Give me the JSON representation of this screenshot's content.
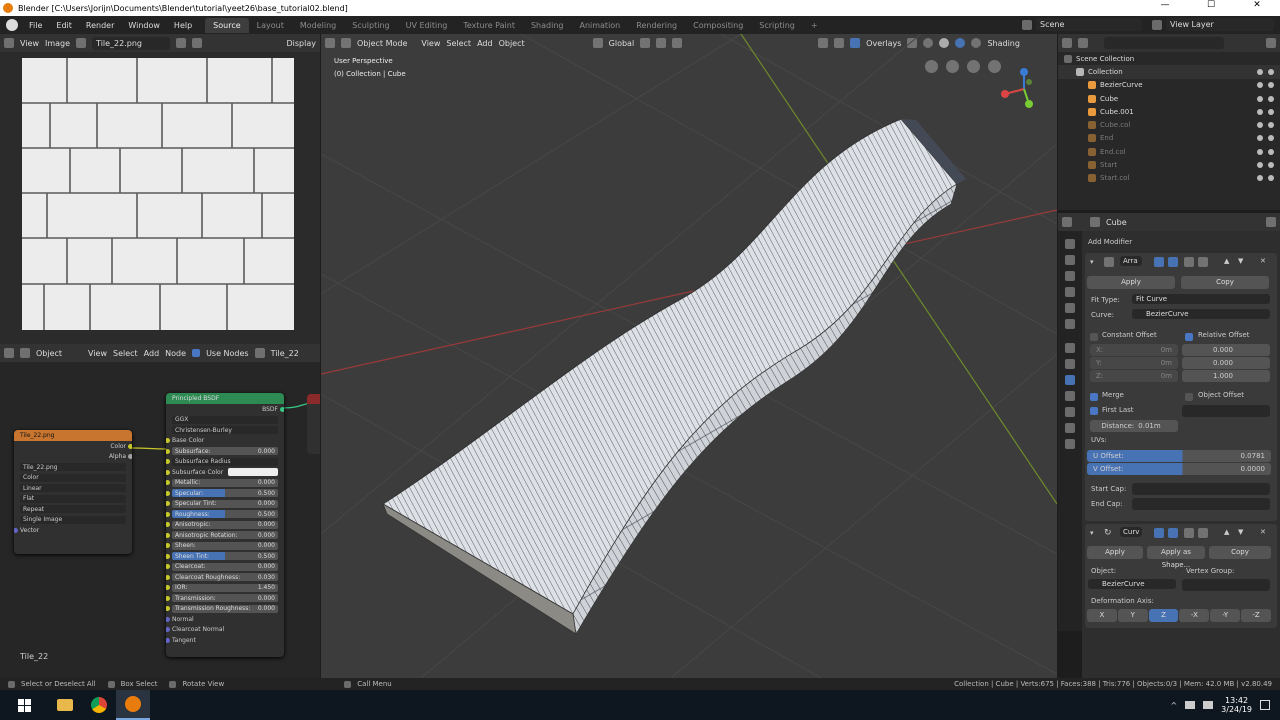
{
  "title_bar": {
    "text": "Blender [C:\\Users\\Jorijn\\Documents\\Blender\\tutorial\\yeet26\\base_tutorial02.blend]",
    "min": "—",
    "max": "☐",
    "close": "✕"
  },
  "menu": [
    "File",
    "Edit",
    "Render",
    "Window",
    "Help"
  ],
  "workspaces": [
    "Source",
    "Layout",
    "Modeling",
    "Sculpting",
    "UV Editing",
    "Texture Paint",
    "Shading",
    "Animation",
    "Rendering",
    "Compositing",
    "Scripting",
    "+"
  ],
  "scene": {
    "name": "Scene",
    "view_layer": "View Layer"
  },
  "image_editor": {
    "view": "View",
    "image": "Image",
    "image_name": "Tile_22.png",
    "display": "Display"
  },
  "node_editor": {
    "object": "Object",
    "view": "View",
    "select": "Select",
    "add": "Add",
    "node": "Node",
    "use_nodes": "Use Nodes",
    "material": "Tile_22",
    "material_label": "Tile_22",
    "image_node": {
      "title": "Tile_22.png",
      "out_color": "Color",
      "out_alpha": "Alpha",
      "image": "Tile_22.png",
      "color": "Color",
      "interp": "Linear",
      "proj": "Flat",
      "ext": "Repeat",
      "source": "Single Image",
      "vector": "Vector"
    },
    "bsdf": {
      "title": "Principled BSDF",
      "out": "BSDF",
      "dist": "GGX",
      "sss": "Christensen-Burley",
      "rows": [
        {
          "label": "Base Color",
          "type": "plain"
        },
        {
          "label": "Subsurface:",
          "value": "0.000",
          "type": "slider"
        },
        {
          "label": "Subsurface Radius",
          "type": "select"
        },
        {
          "label": "Subsurface Color",
          "type": "color"
        },
        {
          "label": "Metallic:",
          "value": "0.000",
          "type": "slider"
        },
        {
          "label": "Specular:",
          "value": "0.500",
          "type": "blue"
        },
        {
          "label": "Specular Tint:",
          "value": "0.000",
          "type": "slider"
        },
        {
          "label": "Roughness:",
          "value": "0.500",
          "type": "blue"
        },
        {
          "label": "Anisotropic:",
          "value": "0.000",
          "type": "slider"
        },
        {
          "label": "Anisotropic Rotation:",
          "value": "0.000",
          "type": "slider"
        },
        {
          "label": "Sheen:",
          "value": "0.000",
          "type": "slider"
        },
        {
          "label": "Sheen Tint:",
          "value": "0.500",
          "type": "blue"
        },
        {
          "label": "Clearcoat:",
          "value": "0.000",
          "type": "slider"
        },
        {
          "label": "Clearcoat Roughness:",
          "value": "0.030",
          "type": "slider"
        },
        {
          "label": "IOR:",
          "value": "1.450",
          "type": "slider"
        },
        {
          "label": "Transmission:",
          "value": "0.000",
          "type": "slider"
        },
        {
          "label": "Transmission Roughness:",
          "value": "0.000",
          "type": "slider"
        },
        {
          "label": "Normal",
          "type": "plain"
        },
        {
          "label": "Clearcoat Normal",
          "type": "plain"
        },
        {
          "label": "Tangent",
          "type": "plain"
        }
      ]
    }
  },
  "viewport": {
    "mode": "Object Mode",
    "view": "View",
    "select": "Select",
    "add": "Add",
    "object": "Object",
    "orientation": "Global",
    "overlays": "Overlays",
    "shading": "Shading",
    "persp": "User Perspective",
    "collection_info": "(0) Collection | Cube"
  },
  "outliner": {
    "root": "Scene Collection",
    "collection": "Collection",
    "items": [
      {
        "name": "BezierCurve",
        "dim": false
      },
      {
        "name": "Cube",
        "dim": false
      },
      {
        "name": "Cube.001",
        "dim": false
      },
      {
        "name": "Cube.col",
        "dim": true
      },
      {
        "name": "End",
        "dim": true
      },
      {
        "name": "End.col",
        "dim": true
      },
      {
        "name": "Start",
        "dim": true
      },
      {
        "name": "Start.col",
        "dim": true
      }
    ]
  },
  "properties": {
    "object": "Cube",
    "add_modifier": "Add Modifier",
    "array": {
      "name": "Arra",
      "apply": "Apply",
      "copy": "Copy",
      "fit_type_label": "Fit Type:",
      "fit_type": "Fit Curve",
      "curve_label": "Curve:",
      "curve": "BezierCurve",
      "constant_offset": "Constant Offset",
      "relative_offset": "Relative Offset",
      "cx": "X:",
      "cy": "Y:",
      "cz": "Z:",
      "cval": "0m",
      "rx": "0.000",
      "ry": "0.000",
      "rz": "1.000",
      "merge": "Merge",
      "object_offset": "Object Offset",
      "first_last": "First Last",
      "distance": "Distance:",
      "distance_val": "0.01m",
      "uvs": "UVs:",
      "u_offset": "U Offset:",
      "u_val": "0.0781",
      "v_offset": "V Offset:",
      "v_val": "0.0000",
      "start_cap": "Start Cap:",
      "end_cap": "End Cap:"
    },
    "curve": {
      "name": "Curv",
      "apply": "Apply",
      "apply_shape": "Apply as Shape...",
      "copy": "Copy",
      "object_label": "Object:",
      "object": "BezierCurve",
      "vgroup": "Vertex Group:",
      "deform": "Deformation Axis:",
      "axes": [
        "X",
        "Y",
        "Z",
        "-X",
        "-Y",
        "-Z"
      ]
    }
  },
  "status": {
    "select": "Select or Deselect All",
    "box": "Box Select",
    "rotate": "Rotate View",
    "menu": "Call Menu",
    "stats": "Collection | Cube | Verts:675 | Faces:388 | Tris:776 | Objects:0/3 | Mem: 42.0 MB | v2.80.49"
  },
  "taskbar": {
    "time": "13:42",
    "date": "3/24/19"
  },
  "colors": {
    "accent": "#4772b3",
    "bg": "#3d3d3d"
  }
}
